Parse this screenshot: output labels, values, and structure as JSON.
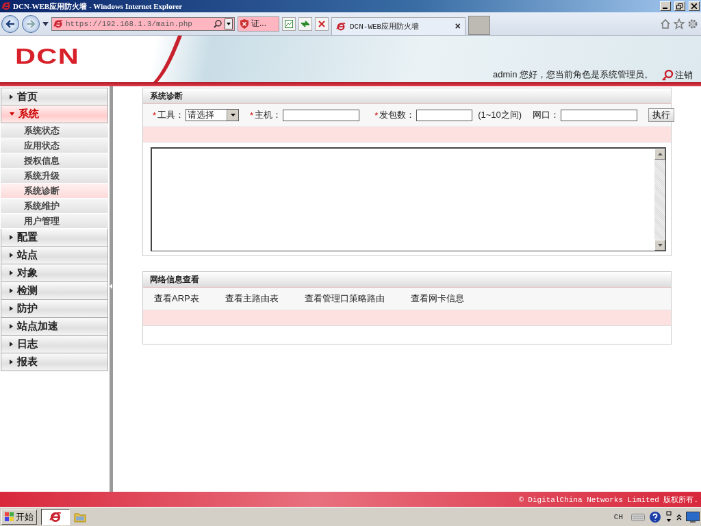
{
  "window": {
    "title": "DCN-WEB应用防火墙 - Windows Internet Explorer"
  },
  "browser": {
    "address": "https://192.168.1.3/main.php",
    "cert_label": "证...",
    "tabs": [
      {
        "label": "DCN-WEB应用防火墙",
        "selected": true
      }
    ],
    "tab_close": "×"
  },
  "header": {
    "logo": "DCN",
    "greeting": "admin 您好，您当前角色是系统管理员。",
    "logout": "注销"
  },
  "sidebar": {
    "items": [
      {
        "label": "首页",
        "expanded": false
      },
      {
        "label": "系统",
        "expanded": true,
        "children": [
          {
            "label": "系统状态",
            "selected": false
          },
          {
            "label": "应用状态",
            "selected": false
          },
          {
            "label": "授权信息",
            "selected": false
          },
          {
            "label": "系统升级",
            "selected": false
          },
          {
            "label": "系统诊断",
            "selected": true
          },
          {
            "label": "系统维护",
            "selected": false
          },
          {
            "label": "用户管理",
            "selected": false
          }
        ]
      },
      {
        "label": "配置",
        "expanded": false
      },
      {
        "label": "站点",
        "expanded": false
      },
      {
        "label": "对象",
        "expanded": false
      },
      {
        "label": "检测",
        "expanded": false
      },
      {
        "label": "防护",
        "expanded": false
      },
      {
        "label": "站点加速",
        "expanded": false
      },
      {
        "label": "日志",
        "expanded": false
      },
      {
        "label": "报表",
        "expanded": false
      }
    ]
  },
  "diagnosis": {
    "title": "系统诊断",
    "fields": [
      {
        "kind": "select",
        "label": "工具：",
        "required": true,
        "value": "请选择"
      },
      {
        "kind": "text",
        "label": "主机：",
        "required": true
      },
      {
        "kind": "text",
        "label": "发包数：",
        "required": true,
        "hint": "(1~10之间)"
      },
      {
        "kind": "text",
        "label": "网口：",
        "required": false
      }
    ],
    "button": "执行",
    "required_mark": "*"
  },
  "network": {
    "title": "网络信息查看",
    "links": [
      "查看ARP表",
      "查看主路由表",
      "查看管理口策略路由",
      "查看网卡信息"
    ]
  },
  "footer": {
    "copyright": "© DigitalChina Networks Limited 版权所有."
  },
  "taskbar": {
    "start": "开始",
    "language": "CH"
  }
}
